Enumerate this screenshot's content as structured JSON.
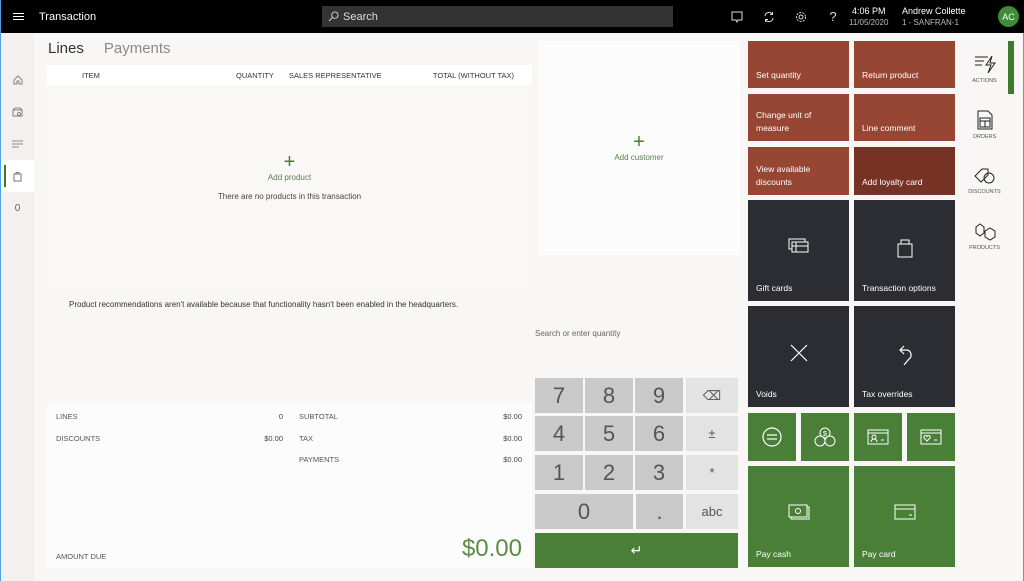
{
  "topbar": {
    "title": "Transaction",
    "search_placeholder": "Search",
    "icons": [
      "feedback-icon",
      "sync-icon",
      "settings-icon",
      "help-icon"
    ],
    "help_glyph": "?",
    "time": "4:06 PM",
    "date": "11/05/2020",
    "user_name": "Andrew Collette",
    "store": "1 - SANFRAN-1",
    "avatar_initials": "AC"
  },
  "leftnav": {
    "items": [
      {
        "icon": "home-icon"
      },
      {
        "icon": "store-icon"
      },
      {
        "icon": "list-icon"
      },
      {
        "icon": "bag-icon",
        "active": true
      },
      {
        "label": "0"
      }
    ]
  },
  "tabs": [
    {
      "label": "Lines",
      "active": true
    },
    {
      "label": "Payments",
      "active": false
    }
  ],
  "lines": {
    "columns": [
      "ITEM",
      "QUANTITY",
      "SALES REPRESENTATIVE",
      "TOTAL (WITHOUT TAX)"
    ],
    "add_product": "Add product",
    "empty_message": "There are no products in this transaction"
  },
  "recommendations_message": "Product recommendations aren't available because that functionality hasn't been enabled in the headquarters.",
  "totals": {
    "lines_label": "LINES",
    "lines_value": "0",
    "discounts_label": "DISCOUNTS",
    "discounts_value": "$0.00",
    "subtotal_label": "SUBTOTAL",
    "subtotal_value": "$0.00",
    "tax_label": "TAX",
    "tax_value": "$0.00",
    "payments_label": "PAYMENTS",
    "payments_value": "$0.00",
    "amount_due_label": "AMOUNT DUE",
    "amount_due_value": "$0.00"
  },
  "customer": {
    "add_customer": "Add customer"
  },
  "numpad": {
    "placeholder": "Search or enter quantity",
    "keys": [
      "7",
      "8",
      "9",
      "⌫",
      "4",
      "5",
      "6",
      "±",
      "1",
      "2",
      "3",
      "*",
      "0",
      ".",
      "abc"
    ],
    "enter_glyph": "↵"
  },
  "actions": {
    "rust": [
      {
        "label": "Set quantity"
      },
      {
        "label": "Return product"
      },
      {
        "label": "Change unit of measure"
      },
      {
        "label": "Line comment"
      },
      {
        "label": "View available discounts"
      },
      {
        "label": "Add loyalty card"
      }
    ],
    "dark": [
      {
        "label": "Gift cards",
        "icon": "gift-card-icon"
      },
      {
        "label": "Transaction options",
        "icon": "shopping-bag-icon"
      },
      {
        "label": "Voids",
        "icon": "close-icon"
      },
      {
        "label": "Tax overrides",
        "icon": "undo-icon"
      }
    ],
    "payment_small": [
      {
        "icon": "pay-exact-icon"
      },
      {
        "icon": "currency-icon"
      },
      {
        "icon": "customer-account-icon"
      },
      {
        "icon": "loyalty-card-icon"
      }
    ],
    "payment_large": [
      {
        "label": "Pay cash",
        "icon": "cash-icon"
      },
      {
        "label": "Pay card",
        "icon": "credit-card-icon"
      }
    ]
  },
  "rightnav": [
    {
      "label": "ACTIONS",
      "active": true
    },
    {
      "label": "ORDERS"
    },
    {
      "label": "DISCOUNTS"
    },
    {
      "label": "PRODUCTS"
    }
  ],
  "colors": {
    "accent_green": "#4a7f38",
    "rust": "#964633",
    "rust_dark": "#763325",
    "tile_dark": "#2b2d33",
    "amount_green": "#5b8c42"
  }
}
